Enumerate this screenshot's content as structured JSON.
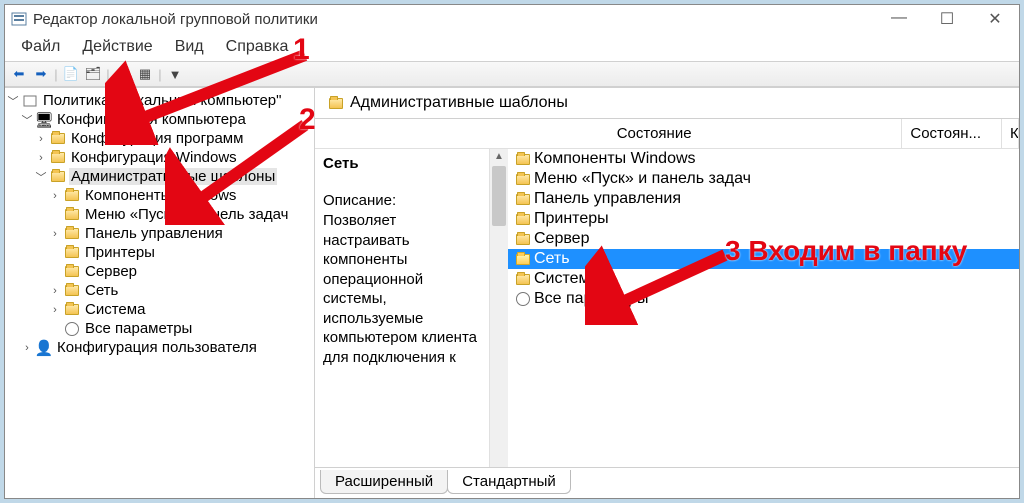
{
  "window": {
    "title": "Редактор локальной групповой политики"
  },
  "menu": {
    "file": "Файл",
    "action": "Действие",
    "view": "Вид",
    "help": "Справка"
  },
  "tree": {
    "root": "Политика \"Локальный компьютер\"",
    "comp": "Конфигурация компьютера",
    "soft": "Конфигурация программ",
    "win": "Конфигурация Windows",
    "adm": "Административные шаблоны",
    "c_win": "Компоненты Windows",
    "c_start": "Меню «Пуск» и панель задач",
    "c_cp": "Панель управления",
    "c_prn": "Принтеры",
    "c_srv": "Сервер",
    "c_net": "Сеть",
    "c_sys": "Система",
    "c_all": "Все параметры",
    "user": "Конфигурация пользователя"
  },
  "right": {
    "header": "Административные шаблоны",
    "section": "Сеть",
    "col_state": "Состояние",
    "col_state2": "Состоян...",
    "col_comment": "Комментари",
    "desc_label": "Описание:",
    "desc_text": "Позволяет настраивать компоненты операционной системы, используемые компьютером клиента для подключения к",
    "items": {
      "win": "Компоненты Windows",
      "start": "Меню «Пуск» и панель задач",
      "cp": "Панель управления",
      "prn": "Принтеры",
      "srv": "Сервер",
      "net": "Сеть",
      "sys": "Система",
      "all": "Все параметры"
    }
  },
  "tabs": {
    "ext": "Расширенный",
    "std": "Стандартный"
  },
  "anno": {
    "n1": "1",
    "n2": "2",
    "n3": "3 Входим в папку"
  }
}
